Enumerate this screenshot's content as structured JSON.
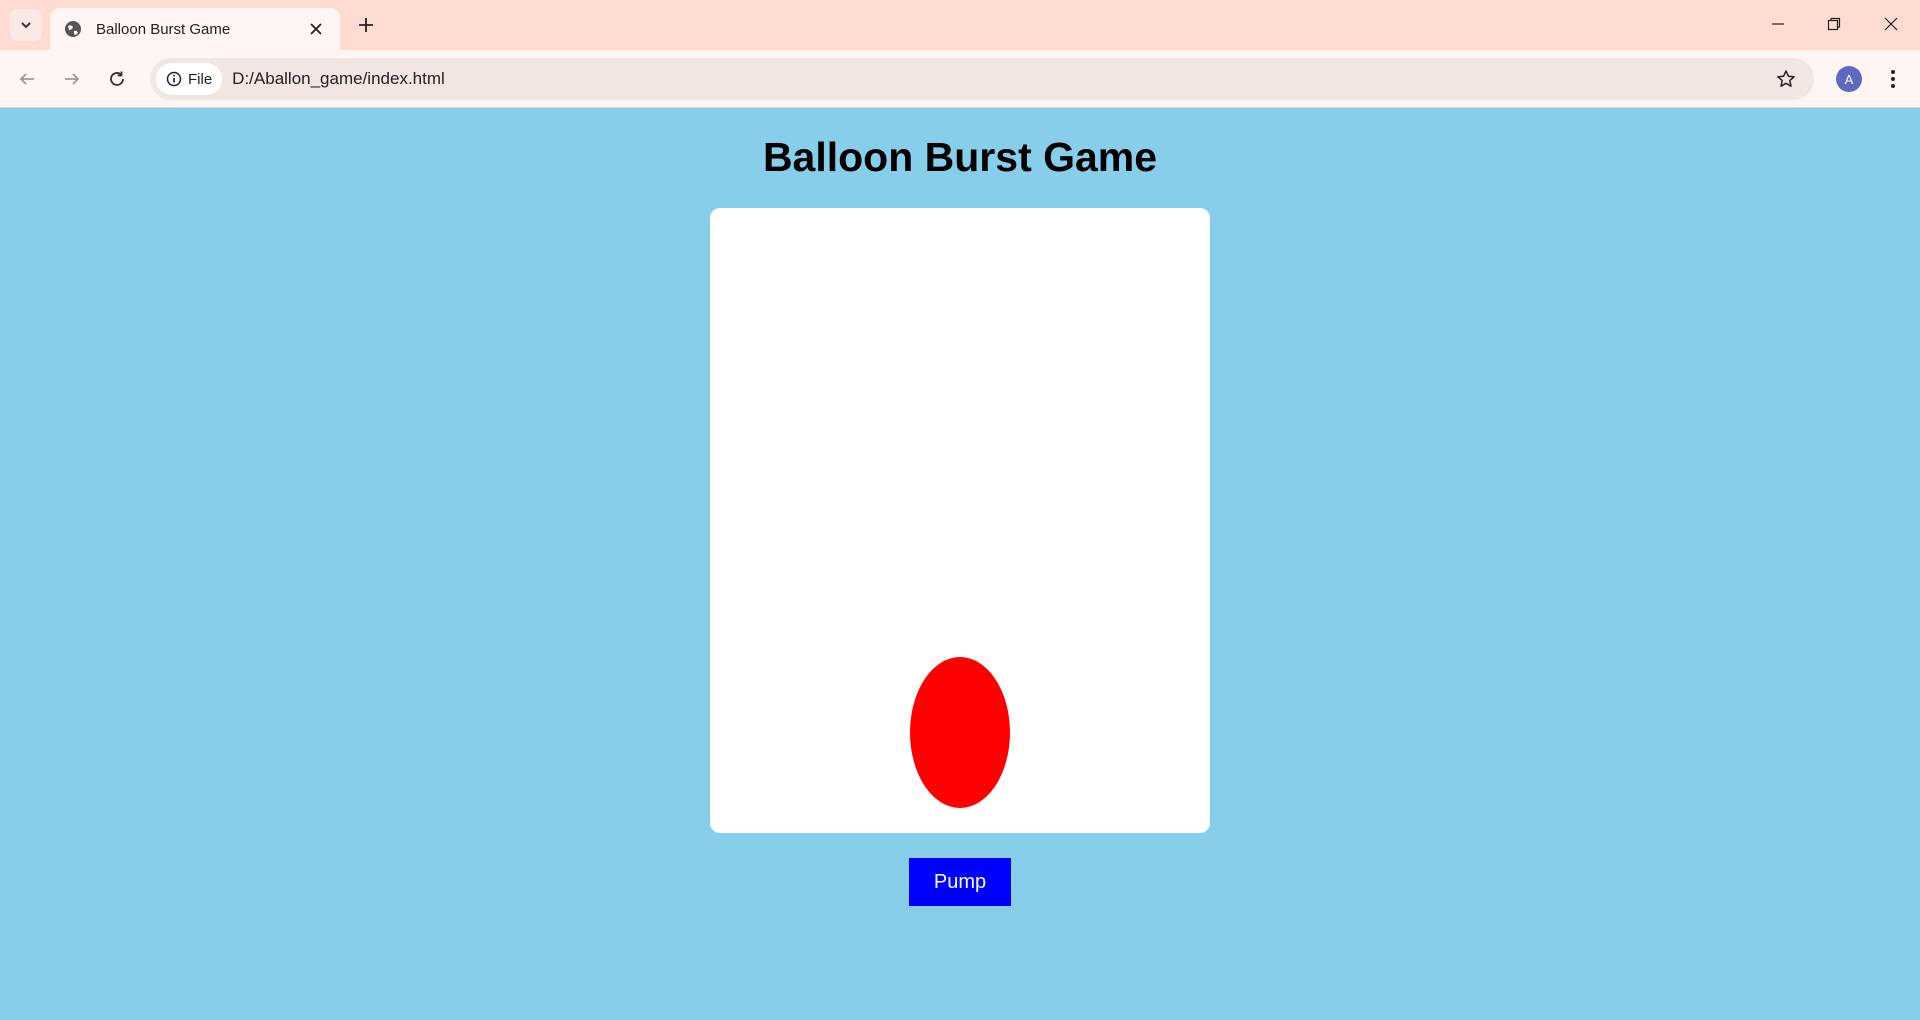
{
  "browser": {
    "tab_title": "Balloon Burst Game",
    "site_chip_label": "File",
    "url": "D:/Aballon_game/index.html",
    "profile_initial": "A"
  },
  "page": {
    "title": "Balloon Burst Game",
    "pump_label": "Pump",
    "colors": {
      "background": "#87ceeb",
      "game_area": "#ffffff",
      "balloon": "#ff0000",
      "pump_button": "#0000ff"
    }
  }
}
